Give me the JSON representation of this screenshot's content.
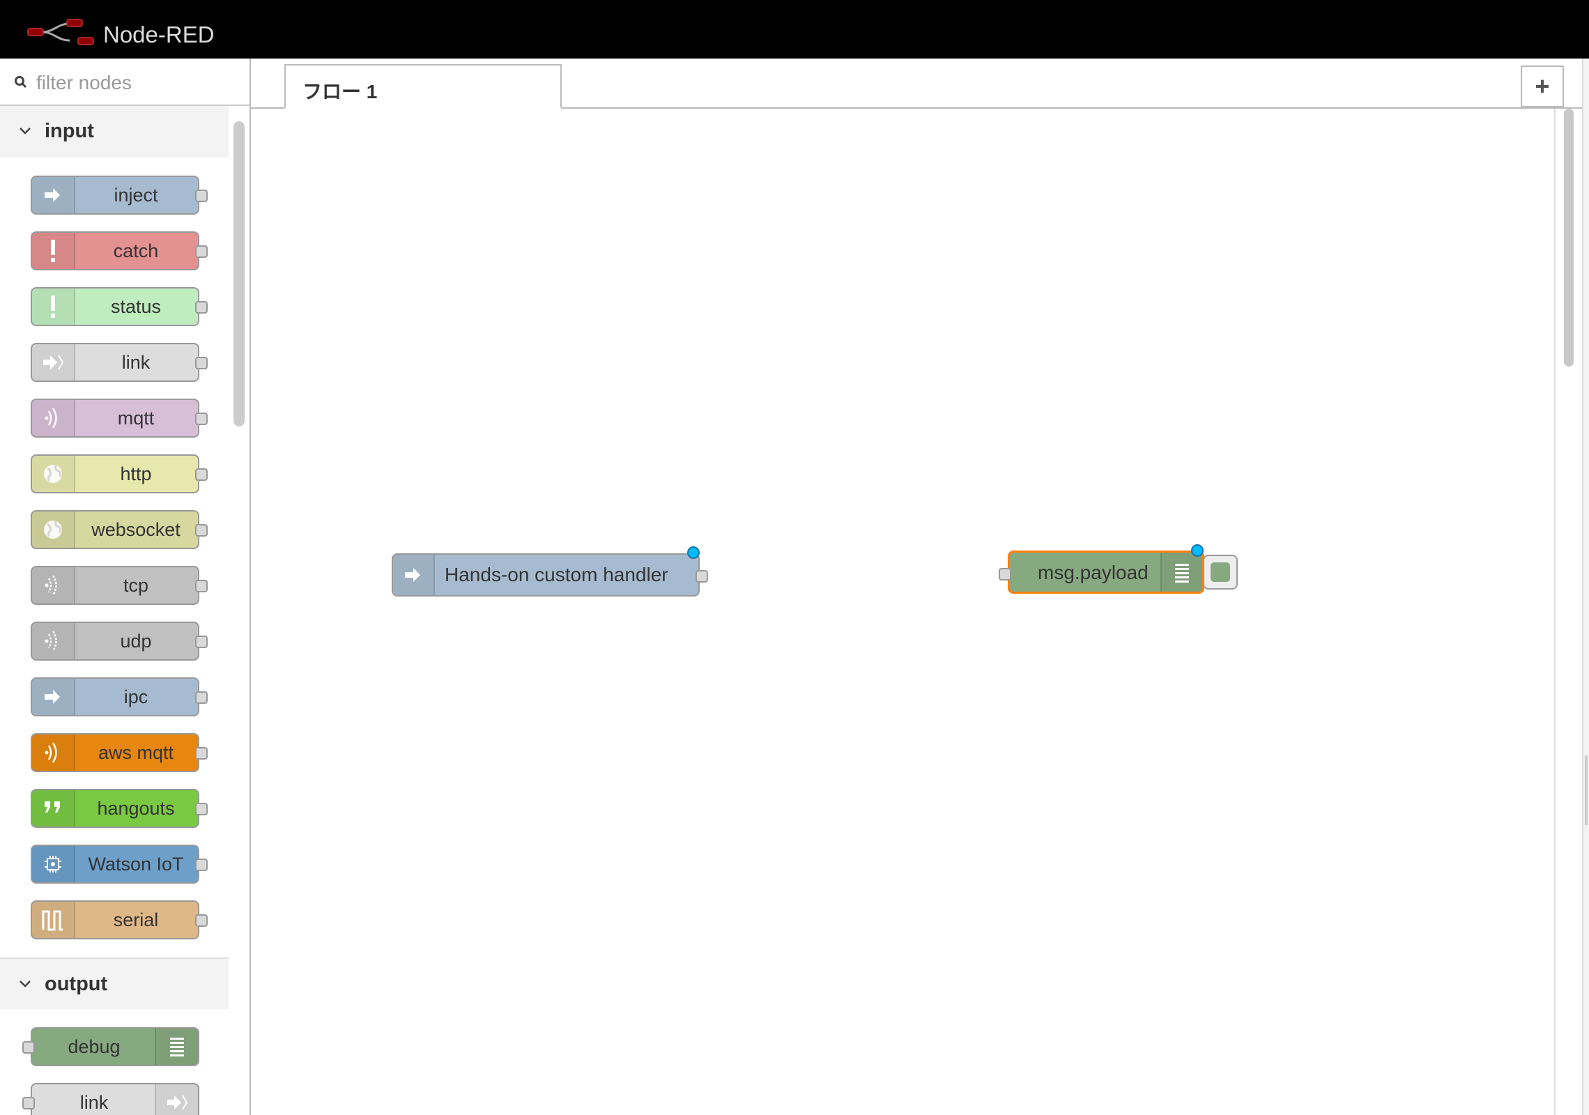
{
  "header": {
    "title": "Node-RED"
  },
  "palette": {
    "filter": {
      "placeholder": "filter nodes",
      "value": ""
    },
    "categories": [
      {
        "label": "input",
        "nodes": [
          {
            "label": "inject",
            "color": "#a6bbcf",
            "icon": "arrow-in-icon"
          },
          {
            "label": "catch",
            "color": "#e49191",
            "icon": "exclamation-icon"
          },
          {
            "label": "status",
            "color": "#c0edc0",
            "icon": "exclamation-icon"
          },
          {
            "label": "link",
            "color": "#dddddd",
            "icon": "link-in-icon"
          },
          {
            "label": "mqtt",
            "color": "#d8bfd8",
            "icon": "bridge-icon"
          },
          {
            "label": "http",
            "color": "#e7e7ae",
            "icon": "globe-icon"
          },
          {
            "label": "websocket",
            "color": "#d7d7a0",
            "icon": "globe-icon"
          },
          {
            "label": "tcp",
            "color": "#c0c0c0",
            "icon": "bridge-dash-icon"
          },
          {
            "label": "udp",
            "color": "#c0c0c0",
            "icon": "bridge-dash-icon"
          },
          {
            "label": "ipc",
            "color": "#a6bbcf",
            "icon": "arrow-in-icon"
          },
          {
            "label": "aws mqtt",
            "color": "#e8870f",
            "icon": "bridge-icon"
          },
          {
            "label": "hangouts",
            "color": "#7ac943",
            "icon": "quote-icon"
          },
          {
            "label": "Watson IoT",
            "color": "#6d9fc9",
            "icon": "chip-icon"
          },
          {
            "label": "serial",
            "color": "#deb887",
            "icon": "serial-icon"
          }
        ]
      },
      {
        "label": "output",
        "nodes": [
          {
            "label": "debug",
            "color": "#87a980",
            "icon": "debug-list-icon"
          },
          {
            "label": "link",
            "color": "#dddddd",
            "icon": "link-out-icon"
          }
        ]
      }
    ]
  },
  "workspace": {
    "tabs": [
      {
        "label": "フロー 1"
      }
    ],
    "add_tab": "+",
    "nodes": [
      {
        "label": "Hands-on custom handler",
        "color": "#a6bbcf",
        "icon": "arrow-in-icon",
        "type": "inject"
      },
      {
        "label": "msg.payload",
        "color": "#87a980",
        "icon": "debug-list-icon",
        "type": "debug",
        "selected_border": "#ff7f0e"
      }
    ]
  }
}
